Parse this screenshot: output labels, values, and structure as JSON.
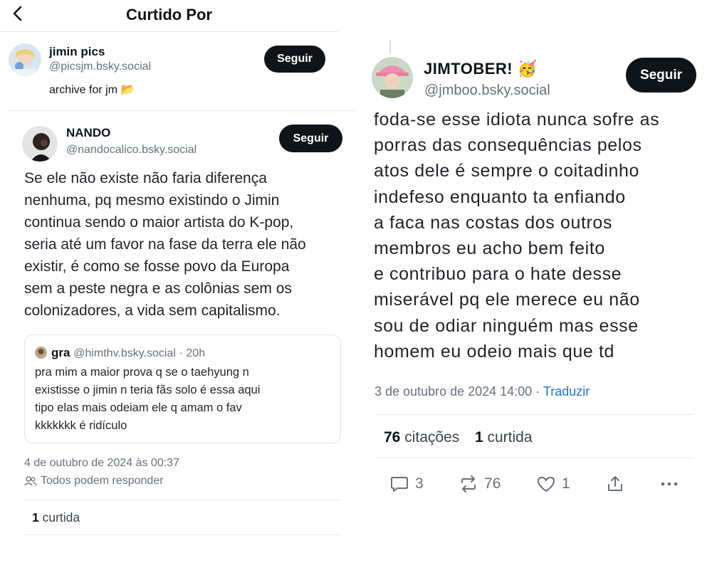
{
  "left": {
    "header": {
      "title": "Curtido Por"
    },
    "liker": {
      "name": "jimin pics",
      "handle": "@picsjm.bsky.social",
      "bio": "archive for jm 📂",
      "follow_label": "Seguir"
    },
    "post": {
      "author_name": "NANDO",
      "author_handle": "@nandocalico.bsky.social",
      "follow_label": "Seguir",
      "text_lines": [
        "Se ele não existe não faria diferença",
        "nenhuma, pq mesmo existindo o Jimin",
        "continua sendo o maior artista do K-pop,",
        "seria até um favor na fase da terra ele não",
        "existir, é como se fosse povo da Europa",
        "sem a peste negra e as colônias sem os",
        "colonizadores, a vida sem capitalismo."
      ],
      "quote": {
        "name": "gra",
        "handle": "@himthv.bsky.social",
        "time": "· 20h",
        "text_lines": [
          "pra mim a maior prova q se o taehyung n",
          "existisse o jimin n teria fãs solo é essa aqui",
          "tipo elas mais odeiam ele q amam o fav",
          "kkkkkkk é ridículo"
        ]
      },
      "timestamp": "4 de outubro de 2024 às 00:37",
      "reply_setting": "Todos podem responder",
      "likes_count": "1",
      "likes_label": "curtida"
    }
  },
  "right": {
    "post": {
      "author_name": "JIMTOBER! 🥳",
      "author_handle": "@jmboo.bsky.social",
      "follow_label": "Seguir",
      "text_lines": [
        "foda-se esse idiota nunca sofre as",
        "porras das consequências pelos",
        "atos dele é sempre o coitadinho",
        "indefeso enquanto ta enfiando",
        "a faca nas costas dos outros",
        "membros eu acho bem feito",
        "e contribuo para o hate desse",
        "miserável pq ele merece eu não",
        "sou de odiar ninguém mas esse",
        "homem eu odeio mais que td"
      ],
      "timestamp": "3 de outubro de 2024 14:00",
      "translate_label": "Traduzir",
      "quotes_count": "76",
      "quotes_label": "citações",
      "likes_count": "1",
      "likes_label": "curtida",
      "actions": {
        "reply_count": "3",
        "repost_count": "76",
        "like_count": "1"
      }
    }
  },
  "icons": [
    "back-arrow-icon",
    "people-icon",
    "reply-icon",
    "repost-icon",
    "heart-icon",
    "share-icon",
    "more-icon"
  ],
  "colors": {
    "follow_button_bg": "#0f1419",
    "link": "#1d73c9",
    "muted": "#66707b",
    "divider": "#e6e8eb"
  }
}
